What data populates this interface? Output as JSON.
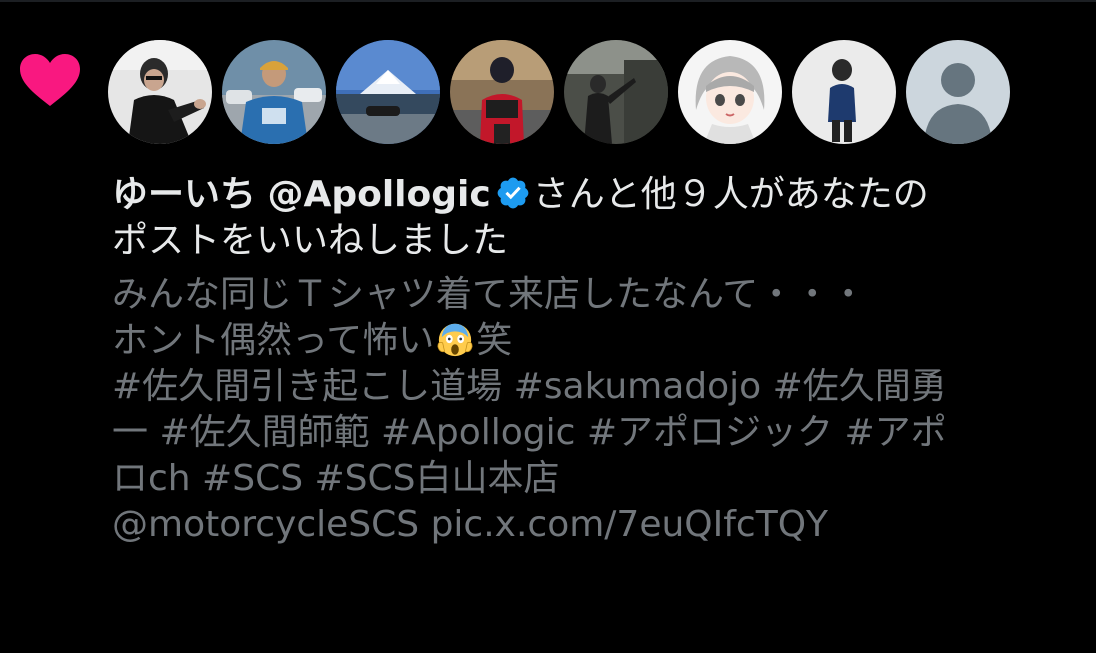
{
  "notification": {
    "type_icon": "heart-icon",
    "accent_color": "#f91880",
    "verified_color": "#1d9bf0",
    "avatars": [
      {
        "name": "avatar-1"
      },
      {
        "name": "avatar-2"
      },
      {
        "name": "avatar-3"
      },
      {
        "name": "avatar-4"
      },
      {
        "name": "avatar-5"
      },
      {
        "name": "avatar-6"
      },
      {
        "name": "avatar-7"
      },
      {
        "name": "avatar-8-default"
      }
    ],
    "headline": {
      "user_name": "ゆーいち",
      "user_handle": "@Apollogic",
      "verified_icon": "verified-badge-icon",
      "text_part1": "さんと他９人があなたの",
      "text_part2": "ポストをいいねしました"
    },
    "post": {
      "line1": "みんな同じＴシャツ着て来店したなんて・・・",
      "line2_text": "ホント偶然って怖い",
      "line2_emoji": "face-screaming-in-fear-emoji",
      "line2_suffix": "笑",
      "line3": "#佐久間引き起こし道場 #sakumadojo #佐久間勇",
      "line4": "一 #佐久間師範 #Apollogic #アポロジック #アポ",
      "line5": "ロch #SCS #SCS白山本店",
      "mention": "@motorcycleSCS",
      "link": "pic.x.com/7euQIfcTQY"
    }
  }
}
